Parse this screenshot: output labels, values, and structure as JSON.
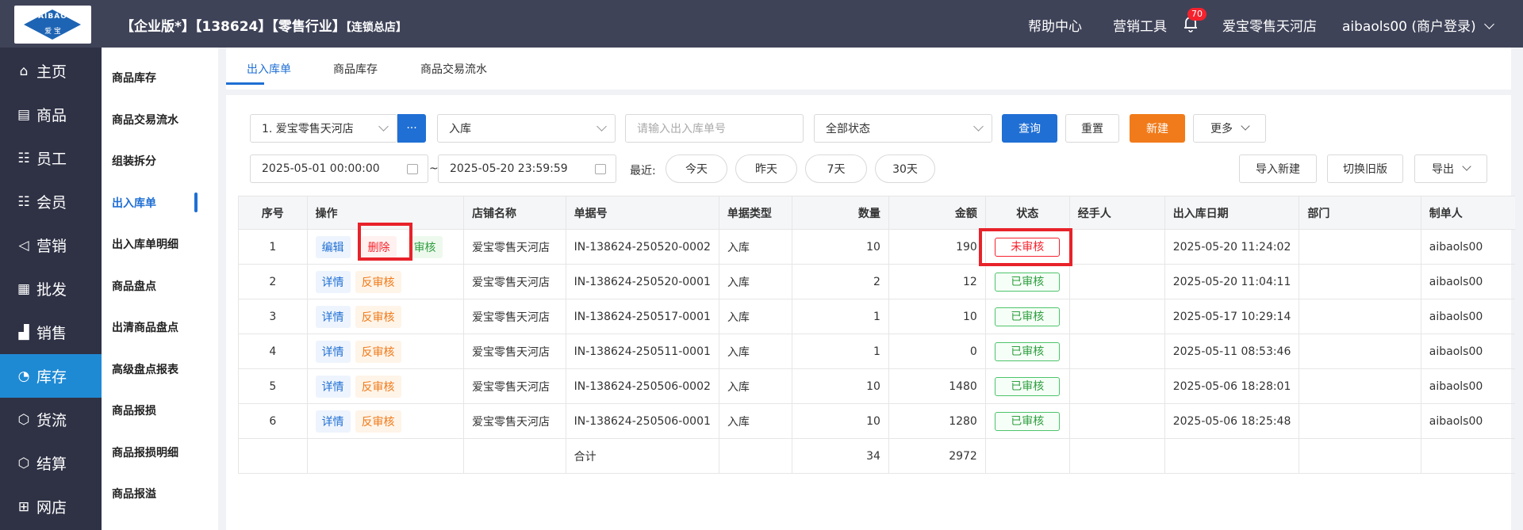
{
  "brand": {
    "logo_text": "AIBAO",
    "logo_sub": "爱 宝"
  },
  "header": {
    "edition": "【企业版*】【138624】【零售行业】",
    "edition_small": "【连锁总店】",
    "help": "帮助中心",
    "marketing_tools": "营销工具",
    "notification_count": "70",
    "store_name": "爱宝零售天河店",
    "user": "aibaols00 (商户登录)"
  },
  "sidebar": {
    "items": [
      {
        "label": "主页",
        "icon": "home-icon"
      },
      {
        "label": "商品",
        "icon": "product-icon"
      },
      {
        "label": "员工",
        "icon": "employee-icon"
      },
      {
        "label": "会员",
        "icon": "member-icon"
      },
      {
        "label": "营销",
        "icon": "marketing-icon"
      },
      {
        "label": "批发",
        "icon": "wholesale-icon"
      },
      {
        "label": "销售",
        "icon": "sales-icon"
      },
      {
        "label": "库存",
        "icon": "inventory-icon"
      },
      {
        "label": "货流",
        "icon": "logistics-icon"
      },
      {
        "label": "结算",
        "icon": "settlement-icon"
      },
      {
        "label": "网店",
        "icon": "shop-icon"
      }
    ]
  },
  "subnav": {
    "items": [
      "商品库存",
      "商品交易流水",
      "组装拆分",
      "出入库单",
      "出入库单明细",
      "商品盘点",
      "出清商品盘点",
      "高级盘点报表",
      "商品报损",
      "商品报损明细",
      "商品报溢"
    ]
  },
  "tabs": [
    "出入库单",
    "商品库存",
    "商品交易流水"
  ],
  "filters": {
    "store": "1. 爱宝零售天河店",
    "more_dots": "···",
    "type": "入库",
    "order_no_placeholder": "请输入出入库单号",
    "status": "全部状态",
    "query": "查询",
    "reset": "重置",
    "new": "新建",
    "more": "更多",
    "date_from": "2025-05-01 00:00:00",
    "tilde": "~",
    "date_to": "2025-05-20 23:59:59",
    "recent_label": "最近:",
    "today": "今天",
    "yesterday": "昨天",
    "d7": "7天",
    "d30": "30天",
    "import_new": "导入新建",
    "switch_old": "切换旧版",
    "export": "导出"
  },
  "table": {
    "headers": [
      "序号",
      "操作",
      "店铺名称",
      "单据号",
      "单据类型",
      "数量",
      "金额",
      "状态",
      "经手人",
      "出入库日期",
      "部门",
      "制单人"
    ],
    "rows": [
      {
        "no": "1",
        "actions": [
          "编辑",
          "删除",
          "审核"
        ],
        "store": "爱宝零售天河店",
        "order": "IN-138624-250520-0002",
        "type": "入库",
        "qty": "10",
        "amount": "190",
        "status": "未审核",
        "handler": "",
        "date": "2025-05-20 11:24:02",
        "dept": "",
        "maker": "aibaols00"
      },
      {
        "no": "2",
        "actions": [
          "详情",
          "反审核"
        ],
        "store": "爱宝零售天河店",
        "order": "IN-138624-250520-0001",
        "type": "入库",
        "qty": "2",
        "amount": "12",
        "status": "已审核",
        "handler": "",
        "date": "2025-05-20 11:04:11",
        "dept": "",
        "maker": "aibaols00"
      },
      {
        "no": "3",
        "actions": [
          "详情",
          "反审核"
        ],
        "store": "爱宝零售天河店",
        "order": "IN-138624-250517-0001",
        "type": "入库",
        "qty": "1",
        "amount": "10",
        "status": "已审核",
        "handler": "",
        "date": "2025-05-17 10:29:14",
        "dept": "",
        "maker": "aibaols00"
      },
      {
        "no": "4",
        "actions": [
          "详情",
          "反审核"
        ],
        "store": "爱宝零售天河店",
        "order": "IN-138624-250511-0001",
        "type": "入库",
        "qty": "1",
        "amount": "0",
        "status": "已审核",
        "handler": "",
        "date": "2025-05-11 08:53:46",
        "dept": "",
        "maker": "aibaols00"
      },
      {
        "no": "5",
        "actions": [
          "详情",
          "反审核"
        ],
        "store": "爱宝零售天河店",
        "order": "IN-138624-250506-0002",
        "type": "入库",
        "qty": "10",
        "amount": "1480",
        "status": "已审核",
        "handler": "",
        "date": "2025-05-06 18:28:01",
        "dept": "",
        "maker": "aibaols00"
      },
      {
        "no": "6",
        "actions": [
          "详情",
          "反审核"
        ],
        "store": "爱宝零售天河店",
        "order": "IN-138624-250506-0001",
        "type": "入库",
        "qty": "10",
        "amount": "1280",
        "status": "已审核",
        "handler": "",
        "date": "2025-05-06 18:25:48",
        "dept": "",
        "maker": "aibaols00"
      }
    ],
    "total_label": "合计",
    "total_qty": "34",
    "total_amount": "2972"
  },
  "colors": {
    "topbar": "#3f4358",
    "sidebar": "#2f3245",
    "active": "#1f8ad4",
    "primary": "#1f6fd4",
    "orange": "#f17b1a",
    "highlight": "#e8222a"
  }
}
